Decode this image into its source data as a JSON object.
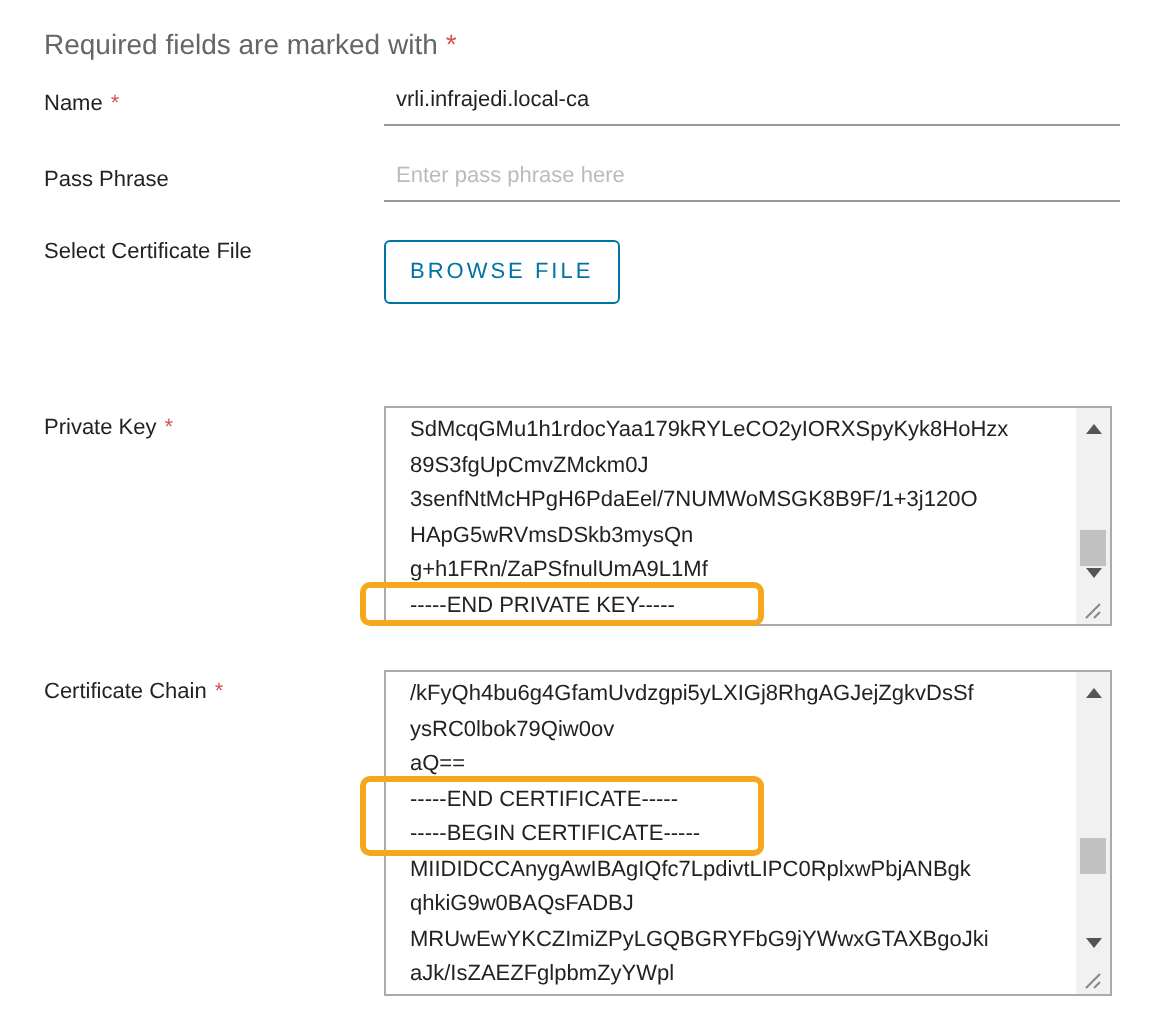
{
  "heading": {
    "text": "Required fields are marked with",
    "required_mark": "*"
  },
  "fields": [
    {
      "kind": "text",
      "label": "Name",
      "required_mark": "*",
      "value": "vrli.infrajedi.local-ca"
    },
    {
      "kind": "text",
      "label": "Pass Phrase",
      "placeholder": "Enter pass phrase here"
    },
    {
      "kind": "file",
      "label": "Select Certificate File",
      "button": "BROWSE FILE"
    },
    {
      "kind": "textarea",
      "label": "Private Key",
      "required_mark": "*",
      "lines": [
        {
          "text": "SdMcqGMu1h1rdocYaa179kRYLeCO2yIORXSpyKyk8HoHzx",
          "highlighted": false
        },
        {
          "text": "89S3fgUpCmvZMckm0J",
          "highlighted": false
        },
        {
          "text": "3senfNtMcHPgH6PdaEel/7NUMWoMSGK8B9F/1+3j120O",
          "highlighted": false
        },
        {
          "text": "HApG5wRVmsDSkb3mysQn",
          "highlighted": false
        },
        {
          "text": "g+h1FRn/ZaPSfnulUmA9L1Mf",
          "highlighted": false
        },
        {
          "text": "-----END PRIVATE KEY-----",
          "highlighted": true
        }
      ]
    },
    {
      "kind": "textarea",
      "label": "Certificate Chain",
      "required_mark": "*",
      "lines": [
        {
          "text": "/kFyQh4bu6g4GfamUvdzgpi5yLXIGj8RhgAGJejZgkvDsSf",
          "highlighted": false
        },
        {
          "text": "ysRC0lbok79Qiw0ov",
          "highlighted": false
        },
        {
          "text": "aQ==",
          "highlighted": false
        },
        {
          "text": "-----END CERTIFICATE-----",
          "highlighted": true
        },
        {
          "text": "-----BEGIN CERTIFICATE-----",
          "highlighted": true
        },
        {
          "text": "MIIDIDCCAnygAwIBAgIQfc7LpdivtLIPC0RplxwPbjANBgk",
          "highlighted": false
        },
        {
          "text": "qhkiG9w0BAQsFADBJ",
          "highlighted": false
        },
        {
          "text": "MRUwEwYKCZImiZPyLGQBGRYFbG9jYWwxGTAXBgoJki",
          "highlighted": false
        },
        {
          "text": "aJk/IsZAEZFglpbmZyYWpl",
          "highlighted": false
        }
      ]
    }
  ]
}
